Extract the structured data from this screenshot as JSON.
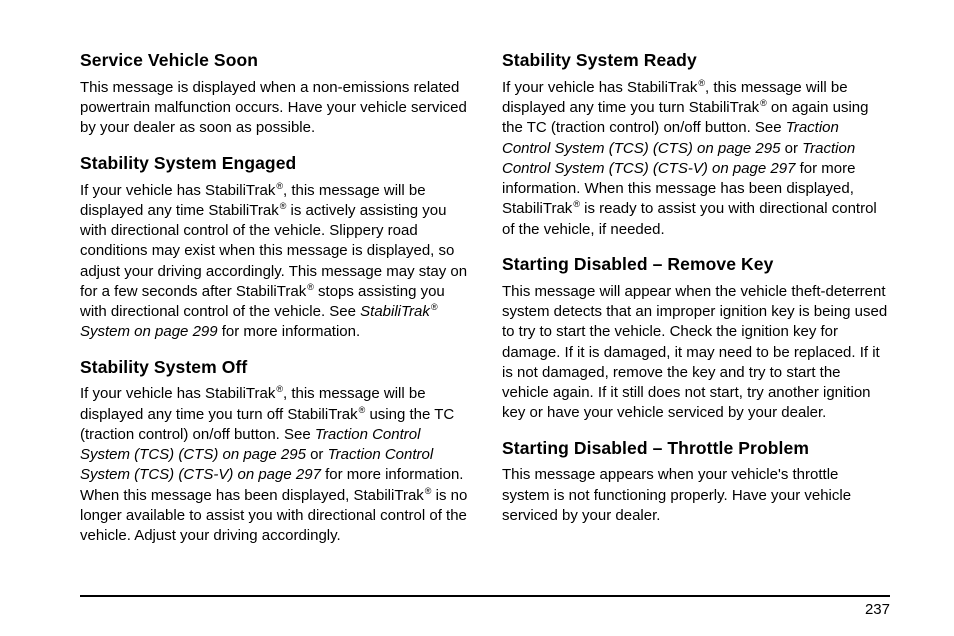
{
  "page": {
    "number": "237",
    "left": {
      "section1": {
        "heading": "Service Vehicle Soon",
        "body": "This message is displayed when a non-emissions related powertrain malfunction occurs. Have your vehicle serviced by your dealer as soon as possible."
      },
      "section2": {
        "heading": "Stability System Engaged",
        "body_pre1": "If your vehicle has StabiliTrak",
        "reg1": "®",
        "body_mid1": ", this message will be displayed any time StabiliTrak",
        "reg2": "®",
        "body_mid2": " is actively assisting you with directional control of the vehicle. Slippery road conditions may exist when this message is displayed, so adjust your driving accordingly. This message may stay on for a few seconds after StabiliTrak",
        "reg3": "®",
        "body_mid3": " stops assisting you with directional control of the vehicle. See ",
        "ref_ital_a": "StabiliTrak",
        "ref_reg": "®",
        "ref_ital_b": " System on page 299",
        "body_post": " for more information."
      },
      "section3": {
        "heading": "Stability System Off",
        "body_pre1": "If your vehicle has StabiliTrak",
        "reg1": "®",
        "body_mid1": ", this message will be displayed any time you turn off StabiliTrak",
        "reg2": "®",
        "body_mid2": " using the TC (traction control) on/off button. See ",
        "ref1_ital": "Traction Control System (TCS) (CTS) on page 295",
        "body_mid3": " or ",
        "ref2_ital": "Traction Control System (TCS) (CTS-V) on page 297",
        "body_mid4": " for more information. When this message has been displayed, StabiliTrak",
        "reg3": "®",
        "body_post": " is no longer available to assist you with directional control of the vehicle. Adjust your driving accordingly."
      }
    },
    "right": {
      "section1": {
        "heading": "Stability System Ready",
        "body_pre1": "If your vehicle has StabiliTrak",
        "reg1": "®",
        "body_mid1": ", this message will be displayed any time you turn StabiliTrak",
        "reg2": "®",
        "body_mid2": " on again using the TC (traction control) on/off button. See ",
        "ref1_ital": "Traction Control System (TCS) (CTS) on page 295",
        "body_mid3": " or ",
        "ref2_ital": "Traction Control System (TCS) (CTS-V) on page 297",
        "body_mid4": " for more information. When this message has been displayed, StabiliTrak",
        "reg3": "®",
        "body_post": " is ready to assist you with directional control of the vehicle, if needed."
      },
      "section2": {
        "heading": "Starting Disabled – Remove Key",
        "body": "This message will appear when the vehicle theft-deterrent system detects that an improper ignition key is being used to try to start the vehicle. Check the ignition key for damage. If it is damaged, it may need to be replaced. If it is not damaged, remove the key and try to start the vehicle again. If it still does not start, try another ignition key or have your vehicle serviced by your dealer."
      },
      "section3": {
        "heading": "Starting Disabled – Throttle Problem",
        "body": "This message appears when your vehicle's throttle system is not functioning properly. Have your vehicle serviced by your dealer."
      }
    }
  }
}
